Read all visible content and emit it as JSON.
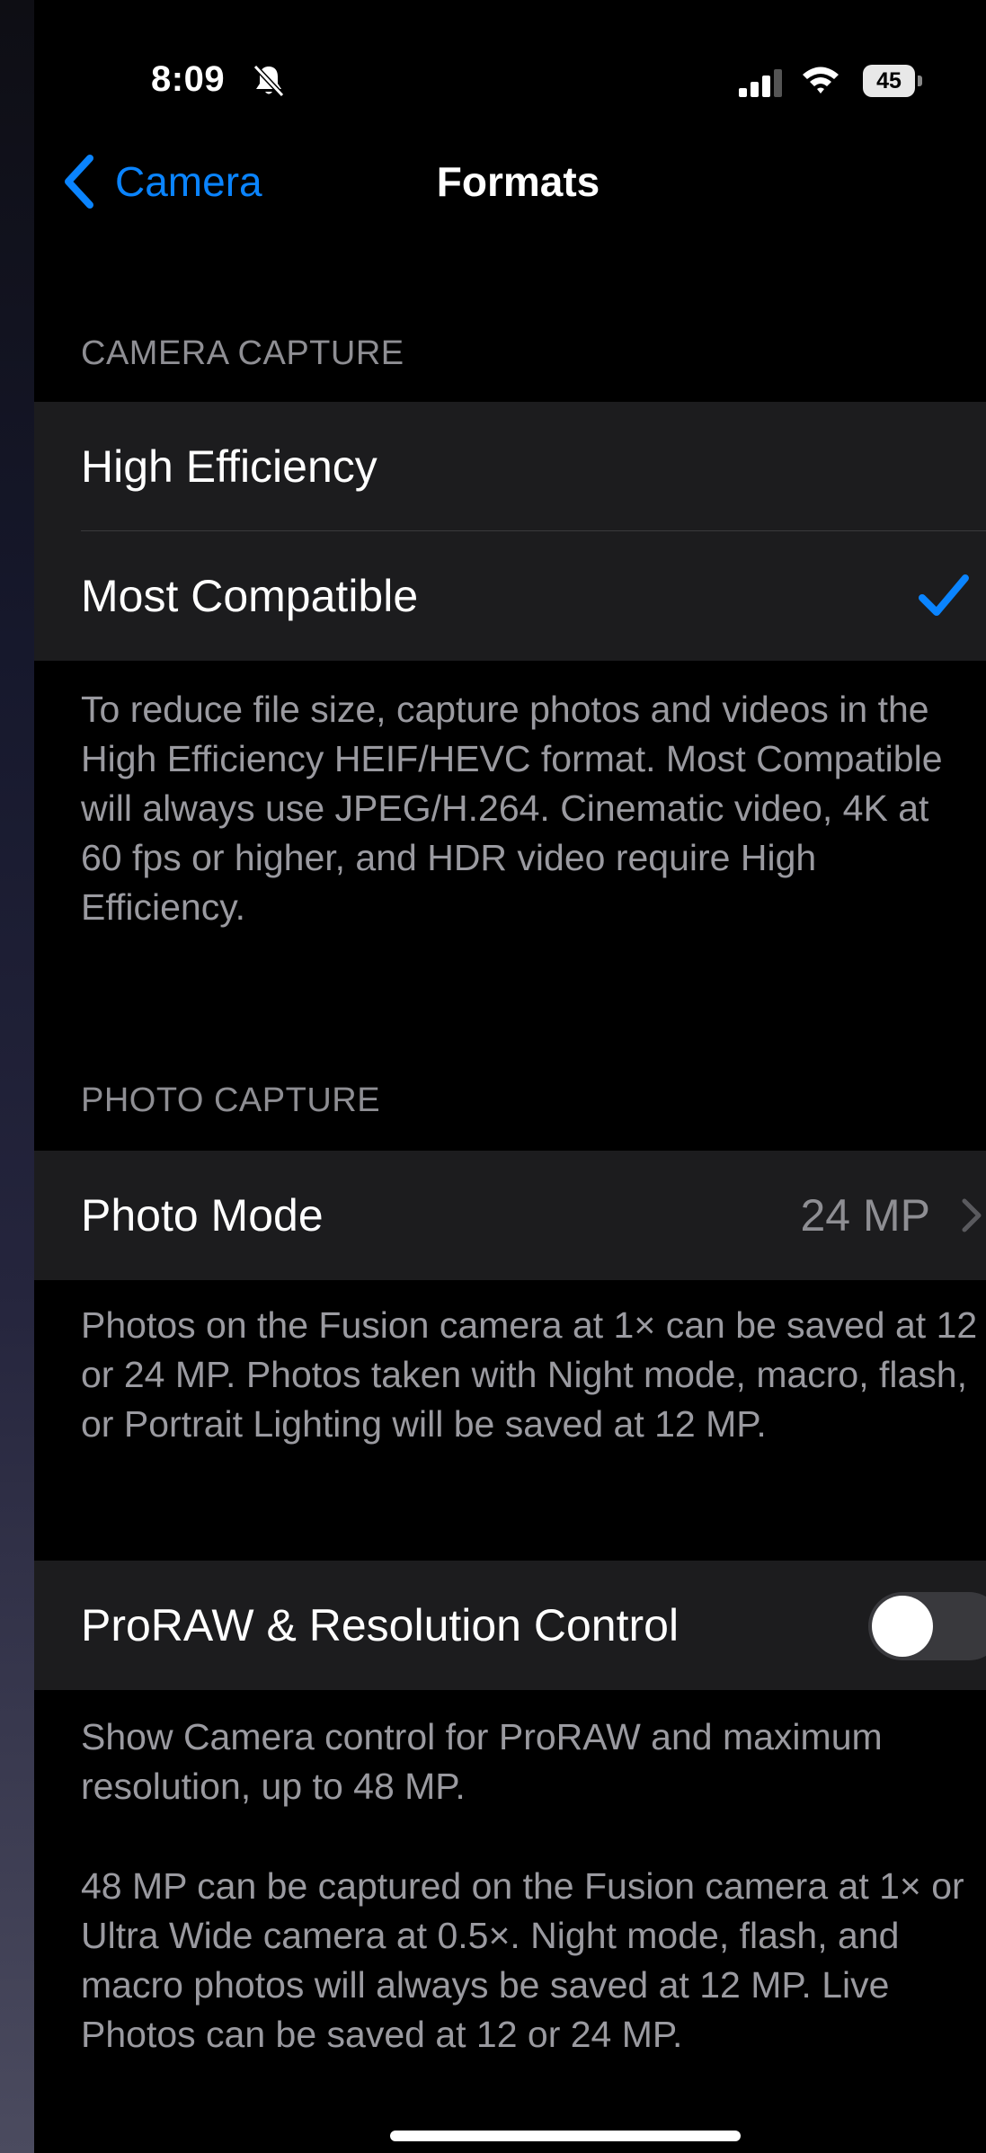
{
  "status_bar": {
    "time": "8:09",
    "battery": "45"
  },
  "nav": {
    "back_label": "Camera",
    "title": "Formats"
  },
  "camera_capture": {
    "header": "CAMERA CAPTURE",
    "options": [
      {
        "label": "High Efficiency",
        "selected": false
      },
      {
        "label": "Most Compatible",
        "selected": true
      }
    ],
    "footer": "To reduce file size, capture photos and videos in the High Efficiency HEIF/HEVC format. Most Compatible will always use JPEG/H.264. Cinematic video, 4K at 60 fps or higher, and HDR video require High Efficiency."
  },
  "photo_capture": {
    "header": "PHOTO CAPTURE",
    "photo_mode_label": "Photo Mode",
    "photo_mode_value": "24 MP",
    "footer": "Photos on the Fusion camera at 1× can be saved at 12 or 24 MP. Photos taken with Night mode, macro, flash, or Portrait Lighting will be saved at 12 MP."
  },
  "proraw": {
    "label": "ProRAW & Resolution Control",
    "enabled": false,
    "footer_1": "Show Camera control for ProRAW and maximum resolution, up to 48 MP.",
    "footer_2": "48 MP can be captured on the Fusion camera at 1× or Ultra Wide camera at 0.5×. Night mode, flash, and macro photos will always be saved at 12 MP. Live Photos can be saved at 12 or 24 MP."
  },
  "colors": {
    "accent": "#0a84ff",
    "cell_background": "#1c1c1e",
    "secondary_text": "#8e8e93"
  }
}
